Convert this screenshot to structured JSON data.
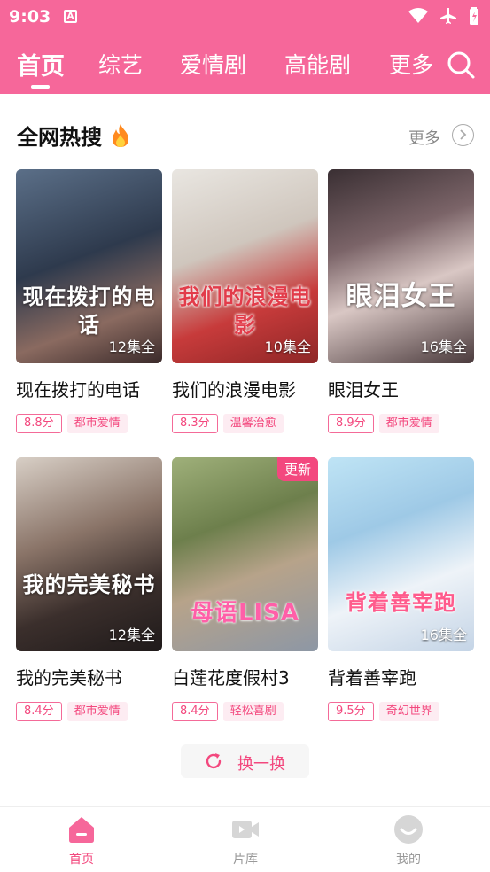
{
  "status_bar": {
    "time": "9:03",
    "notif": "A"
  },
  "nav": {
    "tabs": [
      {
        "label": "首页",
        "active": true
      },
      {
        "label": "综艺",
        "active": false
      },
      {
        "label": "爱情剧",
        "active": false
      },
      {
        "label": "高能剧",
        "active": false
      },
      {
        "label": "更多",
        "active": false
      }
    ]
  },
  "section": {
    "title": "全网热搜",
    "more_label": "更多"
  },
  "dramas": [
    {
      "title": "现在拨打的电话",
      "art": "现在拨打的电话",
      "episodes": "12集全",
      "score": "8.8分",
      "genre": "都市爱情",
      "badge": ""
    },
    {
      "title": "我们的浪漫电影",
      "art": "我们的浪漫电影",
      "episodes": "10集全",
      "score": "8.3分",
      "genre": "温馨治愈",
      "badge": ""
    },
    {
      "title": "眼泪女王",
      "art": "眼泪女王",
      "episodes": "16集全",
      "score": "8.9分",
      "genre": "都市爱情",
      "badge": ""
    },
    {
      "title": "我的完美秘书",
      "art": "我的完美秘书",
      "episodes": "12集全",
      "score": "8.4分",
      "genre": "都市爱情",
      "badge": ""
    },
    {
      "title": "白莲花度假村3",
      "art": "母语LISA",
      "episodes": "",
      "score": "8.4分",
      "genre": "轻松喜剧",
      "badge": "更新"
    },
    {
      "title": "背着善宰跑",
      "art": "背着善宰跑",
      "episodes": "16集全",
      "score": "9.5分",
      "genre": "奇幻世界",
      "badge": ""
    }
  ],
  "refresh_label": "换一换",
  "bottom_nav": [
    {
      "label": "首页",
      "active": true
    },
    {
      "label": "片库",
      "active": false
    },
    {
      "label": "我的",
      "active": false
    }
  ],
  "colors": {
    "accent": "#f6679a",
    "accent_text": "#f3487e",
    "tag_bg": "#fdecf2"
  }
}
